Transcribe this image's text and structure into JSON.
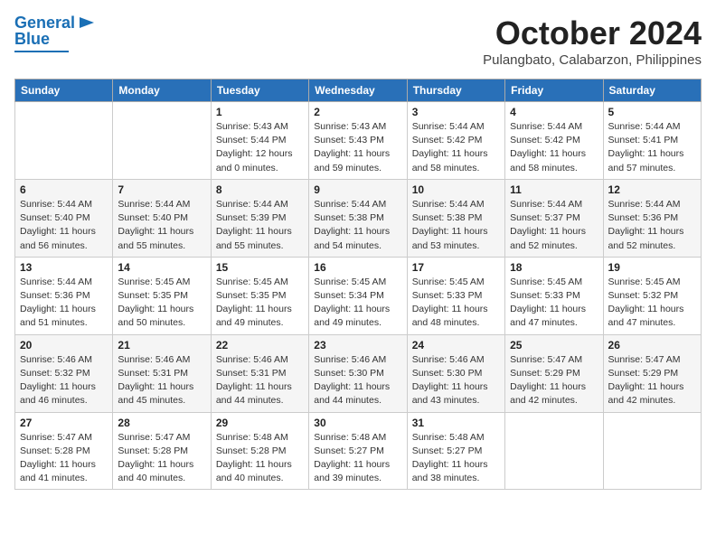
{
  "logo": {
    "line1": "General",
    "line2": "Blue"
  },
  "header": {
    "month": "October 2024",
    "location": "Pulangbato, Calabarzon, Philippines"
  },
  "weekdays": [
    "Sunday",
    "Monday",
    "Tuesday",
    "Wednesday",
    "Thursday",
    "Friday",
    "Saturday"
  ],
  "weeks": [
    [
      {
        "day": "",
        "info": ""
      },
      {
        "day": "",
        "info": ""
      },
      {
        "day": "1",
        "info": "Sunrise: 5:43 AM\nSunset: 5:44 PM\nDaylight: 12 hours\nand 0 minutes."
      },
      {
        "day": "2",
        "info": "Sunrise: 5:43 AM\nSunset: 5:43 PM\nDaylight: 11 hours\nand 59 minutes."
      },
      {
        "day": "3",
        "info": "Sunrise: 5:44 AM\nSunset: 5:42 PM\nDaylight: 11 hours\nand 58 minutes."
      },
      {
        "day": "4",
        "info": "Sunrise: 5:44 AM\nSunset: 5:42 PM\nDaylight: 11 hours\nand 58 minutes."
      },
      {
        "day": "5",
        "info": "Sunrise: 5:44 AM\nSunset: 5:41 PM\nDaylight: 11 hours\nand 57 minutes."
      }
    ],
    [
      {
        "day": "6",
        "info": "Sunrise: 5:44 AM\nSunset: 5:40 PM\nDaylight: 11 hours\nand 56 minutes."
      },
      {
        "day": "7",
        "info": "Sunrise: 5:44 AM\nSunset: 5:40 PM\nDaylight: 11 hours\nand 55 minutes."
      },
      {
        "day": "8",
        "info": "Sunrise: 5:44 AM\nSunset: 5:39 PM\nDaylight: 11 hours\nand 55 minutes."
      },
      {
        "day": "9",
        "info": "Sunrise: 5:44 AM\nSunset: 5:38 PM\nDaylight: 11 hours\nand 54 minutes."
      },
      {
        "day": "10",
        "info": "Sunrise: 5:44 AM\nSunset: 5:38 PM\nDaylight: 11 hours\nand 53 minutes."
      },
      {
        "day": "11",
        "info": "Sunrise: 5:44 AM\nSunset: 5:37 PM\nDaylight: 11 hours\nand 52 minutes."
      },
      {
        "day": "12",
        "info": "Sunrise: 5:44 AM\nSunset: 5:36 PM\nDaylight: 11 hours\nand 52 minutes."
      }
    ],
    [
      {
        "day": "13",
        "info": "Sunrise: 5:44 AM\nSunset: 5:36 PM\nDaylight: 11 hours\nand 51 minutes."
      },
      {
        "day": "14",
        "info": "Sunrise: 5:45 AM\nSunset: 5:35 PM\nDaylight: 11 hours\nand 50 minutes."
      },
      {
        "day": "15",
        "info": "Sunrise: 5:45 AM\nSunset: 5:35 PM\nDaylight: 11 hours\nand 49 minutes."
      },
      {
        "day": "16",
        "info": "Sunrise: 5:45 AM\nSunset: 5:34 PM\nDaylight: 11 hours\nand 49 minutes."
      },
      {
        "day": "17",
        "info": "Sunrise: 5:45 AM\nSunset: 5:33 PM\nDaylight: 11 hours\nand 48 minutes."
      },
      {
        "day": "18",
        "info": "Sunrise: 5:45 AM\nSunset: 5:33 PM\nDaylight: 11 hours\nand 47 minutes."
      },
      {
        "day": "19",
        "info": "Sunrise: 5:45 AM\nSunset: 5:32 PM\nDaylight: 11 hours\nand 47 minutes."
      }
    ],
    [
      {
        "day": "20",
        "info": "Sunrise: 5:46 AM\nSunset: 5:32 PM\nDaylight: 11 hours\nand 46 minutes."
      },
      {
        "day": "21",
        "info": "Sunrise: 5:46 AM\nSunset: 5:31 PM\nDaylight: 11 hours\nand 45 minutes."
      },
      {
        "day": "22",
        "info": "Sunrise: 5:46 AM\nSunset: 5:31 PM\nDaylight: 11 hours\nand 44 minutes."
      },
      {
        "day": "23",
        "info": "Sunrise: 5:46 AM\nSunset: 5:30 PM\nDaylight: 11 hours\nand 44 minutes."
      },
      {
        "day": "24",
        "info": "Sunrise: 5:46 AM\nSunset: 5:30 PM\nDaylight: 11 hours\nand 43 minutes."
      },
      {
        "day": "25",
        "info": "Sunrise: 5:47 AM\nSunset: 5:29 PM\nDaylight: 11 hours\nand 42 minutes."
      },
      {
        "day": "26",
        "info": "Sunrise: 5:47 AM\nSunset: 5:29 PM\nDaylight: 11 hours\nand 42 minutes."
      }
    ],
    [
      {
        "day": "27",
        "info": "Sunrise: 5:47 AM\nSunset: 5:28 PM\nDaylight: 11 hours\nand 41 minutes."
      },
      {
        "day": "28",
        "info": "Sunrise: 5:47 AM\nSunset: 5:28 PM\nDaylight: 11 hours\nand 40 minutes."
      },
      {
        "day": "29",
        "info": "Sunrise: 5:48 AM\nSunset: 5:28 PM\nDaylight: 11 hours\nand 40 minutes."
      },
      {
        "day": "30",
        "info": "Sunrise: 5:48 AM\nSunset: 5:27 PM\nDaylight: 11 hours\nand 39 minutes."
      },
      {
        "day": "31",
        "info": "Sunrise: 5:48 AM\nSunset: 5:27 PM\nDaylight: 11 hours\nand 38 minutes."
      },
      {
        "day": "",
        "info": ""
      },
      {
        "day": "",
        "info": ""
      }
    ]
  ]
}
